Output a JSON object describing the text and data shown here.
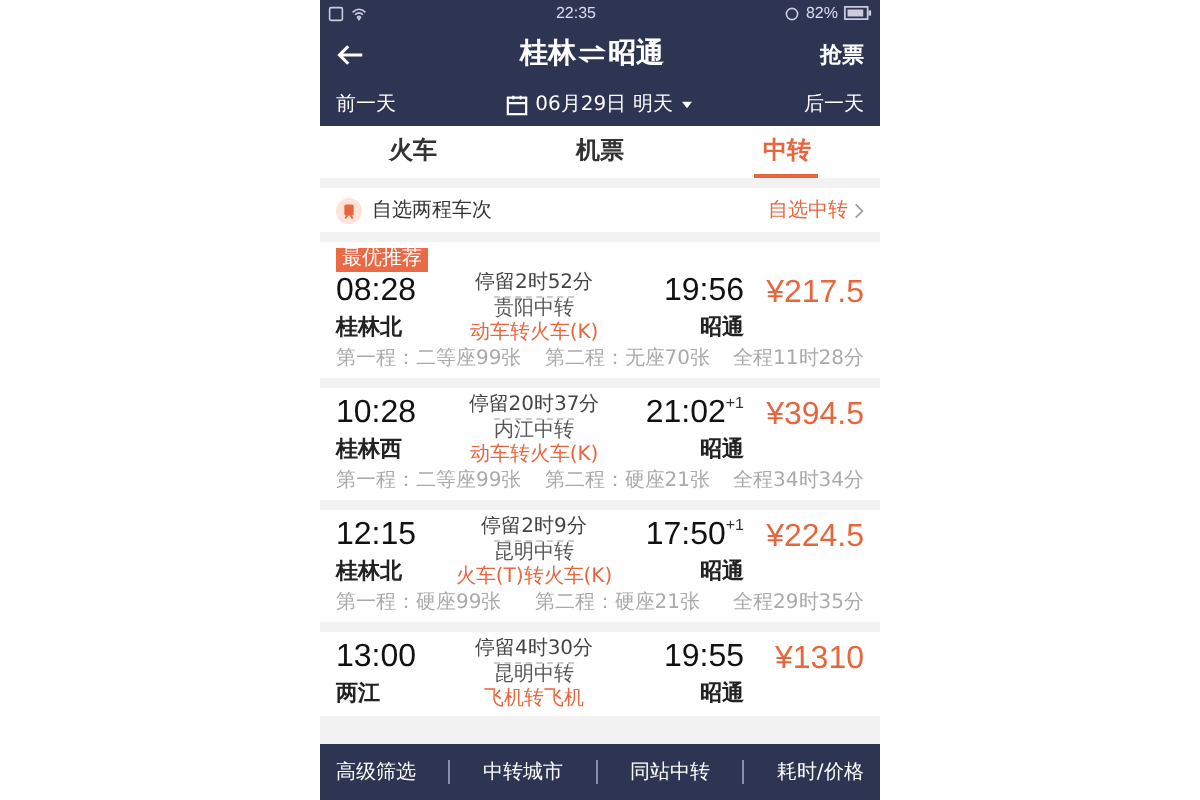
{
  "status_bar": {
    "time": "22:35",
    "battery": "82%"
  },
  "header": {
    "from": "桂林",
    "to": "昭通",
    "action": "抢票"
  },
  "date_bar": {
    "prev": "前一天",
    "date": "06月29日 明天",
    "next": "后一天"
  },
  "tabs": [
    {
      "label": "火车",
      "selected": false
    },
    {
      "label": "机票",
      "selected": false
    },
    {
      "label": "中转",
      "selected": true
    }
  ],
  "custom_row": {
    "label": "自选两程车次",
    "link": "自选中转"
  },
  "trips": [
    {
      "badge": "最优推荐",
      "depart": "08:28",
      "depart_station": "桂林北",
      "stopover": "停留2时52分",
      "transfer": "贵阳中转",
      "mode": "动车转火车(K)",
      "arrive": "19:56",
      "arrive_station": "昭通",
      "price": "¥217.5",
      "leg1": "第一程：二等座99张",
      "leg2": "第二程：无座70张",
      "total": "全程11时28分"
    },
    {
      "depart": "10:28",
      "depart_station": "桂林西",
      "stopover": "停留20时37分",
      "transfer": "内江中转",
      "mode": "动车转火车(K)",
      "arrive": "21:02",
      "next_day": "+1",
      "arrive_station": "昭通",
      "price": "¥394.5",
      "leg1": "第一程：二等座99张",
      "leg2": "第二程：硬座21张",
      "total": "全程34时34分"
    },
    {
      "depart": "12:15",
      "depart_station": "桂林北",
      "stopover": "停留2时9分",
      "transfer": "昆明中转",
      "mode": "火车(T)转火车(K)",
      "arrive": "17:50",
      "next_day": "+1",
      "arrive_station": "昭通",
      "price": "¥224.5",
      "leg1": "第一程：硬座99张",
      "leg2": "第二程：硬座21张",
      "total": "全程29时35分"
    },
    {
      "depart": "13:00",
      "depart_station": "两江",
      "stopover": "停留4时30分",
      "transfer": "昆明中转",
      "mode": "飞机转飞机",
      "arrive": "19:55",
      "arrive_station": "昭通",
      "price": "¥1310"
    }
  ],
  "bottom_bar": [
    "高级筛选",
    "中转城市",
    "同站中转",
    "耗时/价格"
  ]
}
